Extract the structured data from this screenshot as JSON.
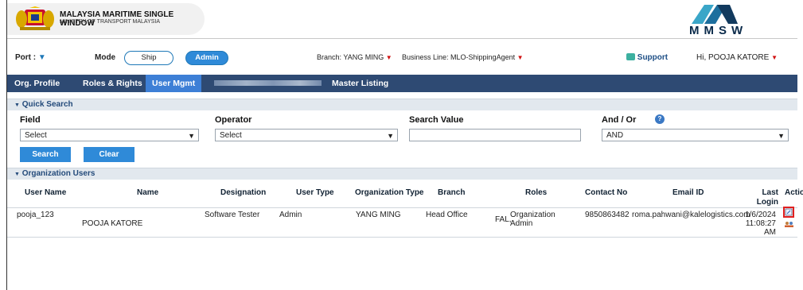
{
  "header": {
    "org_title": "MALAYSIA MARITIME SINGLE WINDOW",
    "org_subtitle": "MINISTRY OF TRANSPORT MALAYSIA",
    "brand_text": "MMSW"
  },
  "toolbar": {
    "port_label": "Port :",
    "mode_label": "Mode",
    "mode_ship": "Ship",
    "mode_admin": "Admin",
    "branch_label": "Branch: YANG MING",
    "business_line_label": "Business Line: MLO-ShippingAgent",
    "support_label": "Support",
    "user_greeting": "Hi, POOJA KATORE"
  },
  "nav": {
    "items": [
      {
        "label": "Org. Profile"
      },
      {
        "label": "Roles & Rights"
      },
      {
        "label": "User Mgmt"
      },
      {
        "label": "Master Listing"
      }
    ]
  },
  "quick_search": {
    "title": "Quick Search",
    "field_label": "Field",
    "field_value": "Select",
    "operator_label": "Operator",
    "operator_value": "Select",
    "search_value_label": "Search Value",
    "search_value": "",
    "andor_label": "And / Or",
    "andor_value": "AND",
    "search_button": "Search",
    "clear_button": "Clear"
  },
  "org_users": {
    "title": "Organization Users",
    "columns": [
      "User Name",
      "Name",
      "Designation",
      "User Type",
      "Organization Type",
      "Branch",
      "Roles",
      "Contact No",
      "Email ID",
      "Last Login",
      "Action"
    ],
    "rows": [
      {
        "user_name": "pooja_123",
        "name": "POOJA KATORE",
        "designation": "Software Tester",
        "user_type": "Admin",
        "organization_type": "YANG MING",
        "branch": "Head Office",
        "roles_prefix": "FAL,",
        "roles_line1": "Organization",
        "roles_line2": "Admin",
        "contact_no": "9850863482",
        "email": "roma.pahwani@kalelogistics.com",
        "last_login_1": "1/6/2024",
        "last_login_2": "11:08:27",
        "last_login_3": "AM"
      }
    ]
  },
  "colors": {
    "nav_bg": "#2e4a73",
    "nav_active": "#3d7fd6",
    "button_blue": "#2f8ad8",
    "highlight_red": "#e02020"
  }
}
